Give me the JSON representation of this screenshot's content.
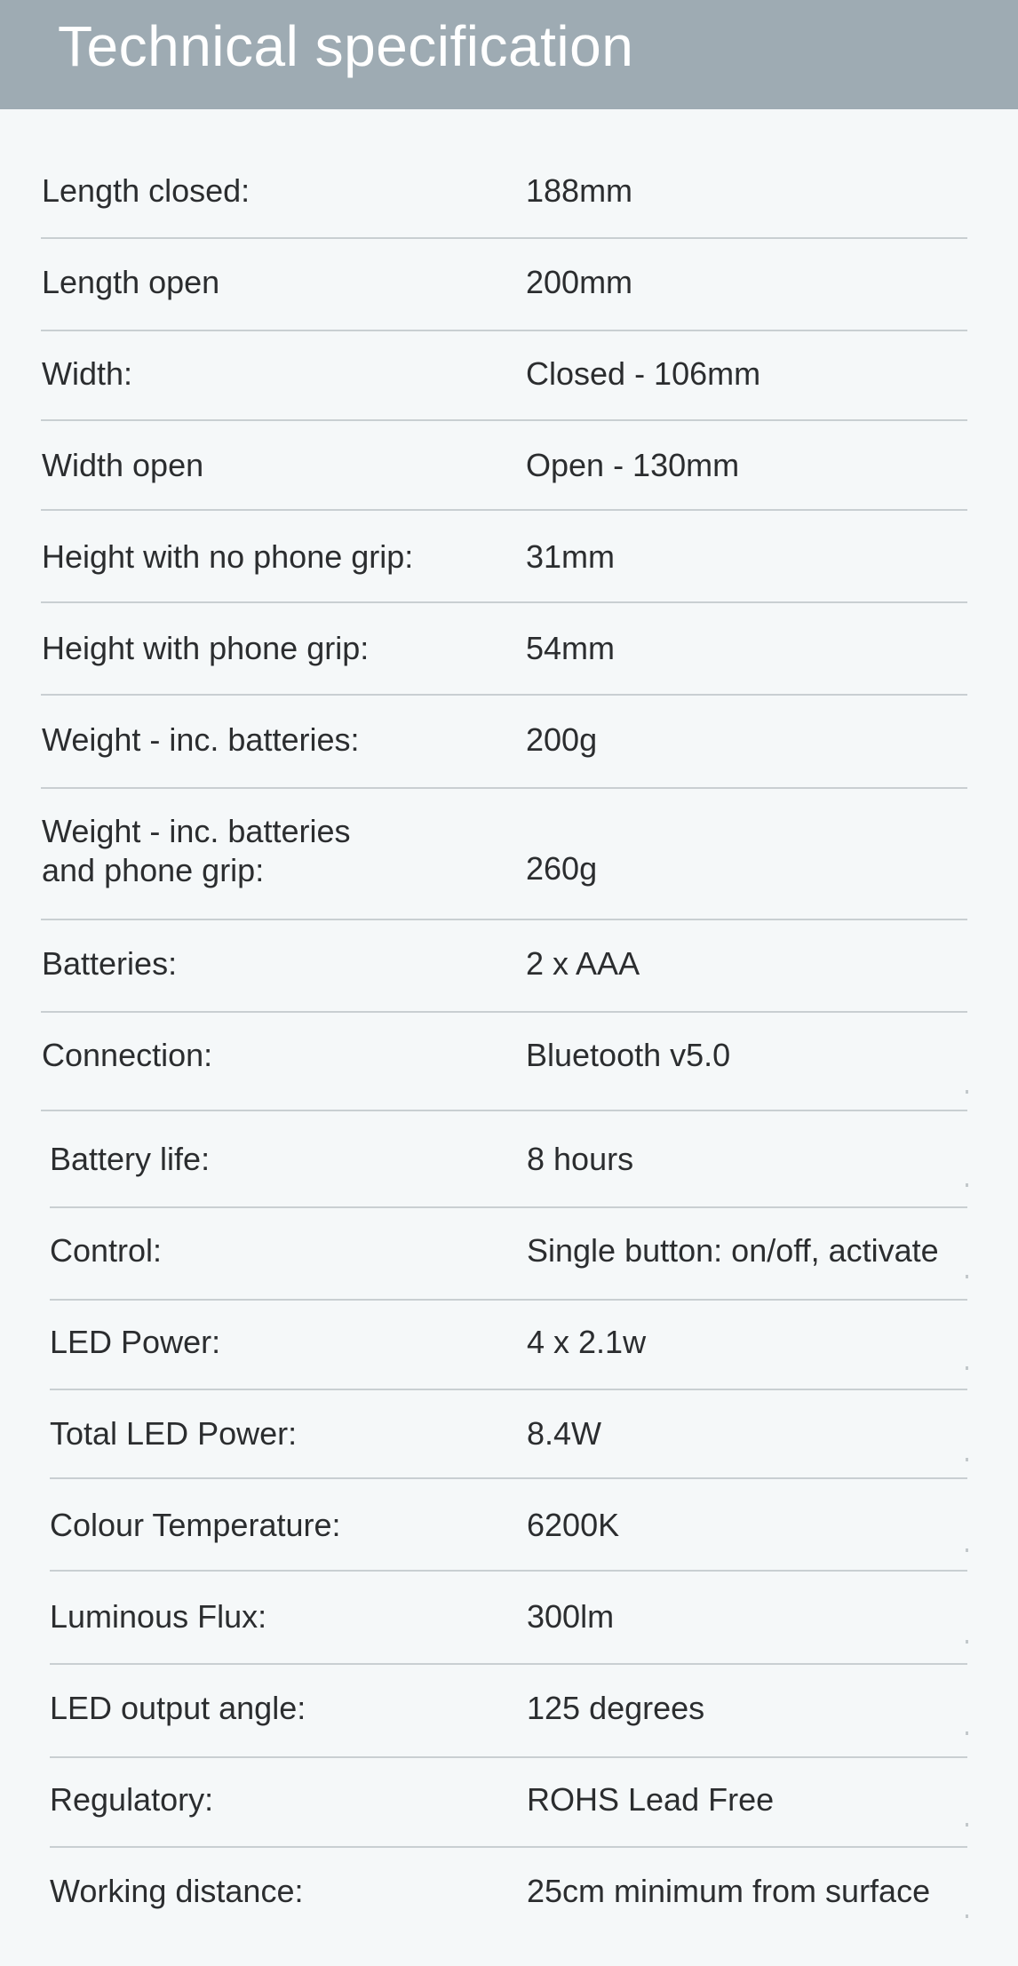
{
  "header": {
    "title": "Technical specification"
  },
  "specs": [
    {
      "label": "Length closed:",
      "value": "188mm"
    },
    {
      "label": "Length open",
      "value": "200mm"
    },
    {
      "label": "Width:",
      "value": "Closed - 106mm"
    },
    {
      "label": "Width open",
      "value": "Open - 130mm"
    },
    {
      "label": "Height with no phone grip:",
      "value": "31mm"
    },
    {
      "label": "Height with phone grip:",
      "value": "54mm"
    },
    {
      "label": "Weight - inc. batteries:",
      "value": "200g"
    },
    {
      "label": "Weight - inc. batteries\nand phone grip:",
      "value": "260g"
    },
    {
      "label": "Batteries:",
      "value": "2 x AAA"
    },
    {
      "label": "Connection:",
      "value": "Bluetooth v5.0"
    },
    {
      "label": "Battery life:",
      "value": "8 hours"
    },
    {
      "label": "Control:",
      "value": "Single button: on/off, activate"
    },
    {
      "label": "LED Power:",
      "value": "4 x 2.1w"
    },
    {
      "label": "Total LED Power:",
      "value": "8.4W"
    },
    {
      "label": "Colour Temperature:",
      "value": "6200K"
    },
    {
      "label": "Luminous Flux:",
      "value": "300lm"
    },
    {
      "label": "LED output angle:",
      "value": "125 degrees"
    },
    {
      "label": "Regulatory:",
      "value": "ROHS Lead Free"
    },
    {
      "label": "Working distance:",
      "value": "25cm minimum from surface"
    }
  ]
}
